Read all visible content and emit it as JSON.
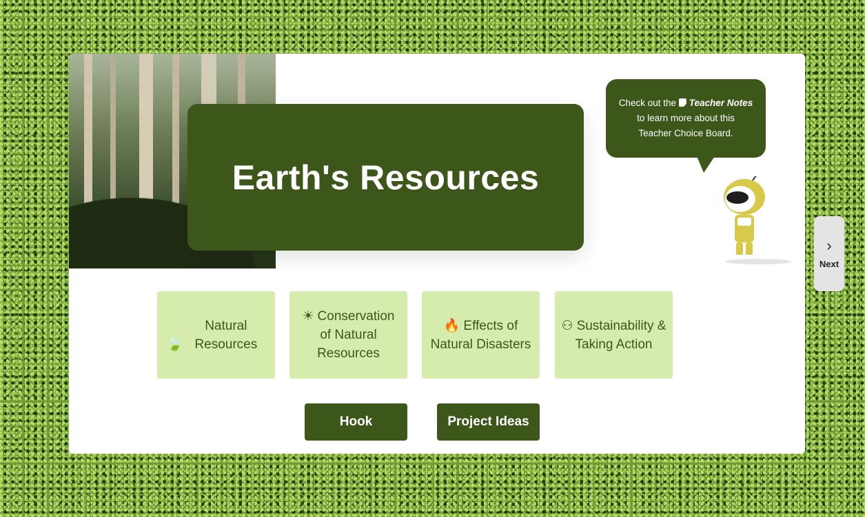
{
  "header": {
    "title": "Earth's Resources"
  },
  "bubble": {
    "line1_prefix": "Check out the",
    "notes_label": "Teacher Notes",
    "line2": "to learn more about this",
    "line3": "Teacher Choice Board."
  },
  "tiles": [
    {
      "icon": "leaf-icon",
      "glyph": "🍃",
      "label": "Natural Resources"
    },
    {
      "icon": "sun-icon",
      "glyph": "☀",
      "label": "Conservation of Natural Resources"
    },
    {
      "icon": "fire-icon",
      "glyph": "🔥",
      "label": "Effects of Natural Disasters"
    },
    {
      "icon": "people-globe-icon",
      "glyph": "⚇",
      "label": "Sustainability & Taking Action"
    }
  ],
  "buttons": {
    "hook": "Hook",
    "project_ideas": "Project Ideas"
  },
  "nav": {
    "next_label": "Next"
  },
  "colors": {
    "primary": "#3d571b",
    "tile": "#d5ecac",
    "card": "#ffffff"
  }
}
